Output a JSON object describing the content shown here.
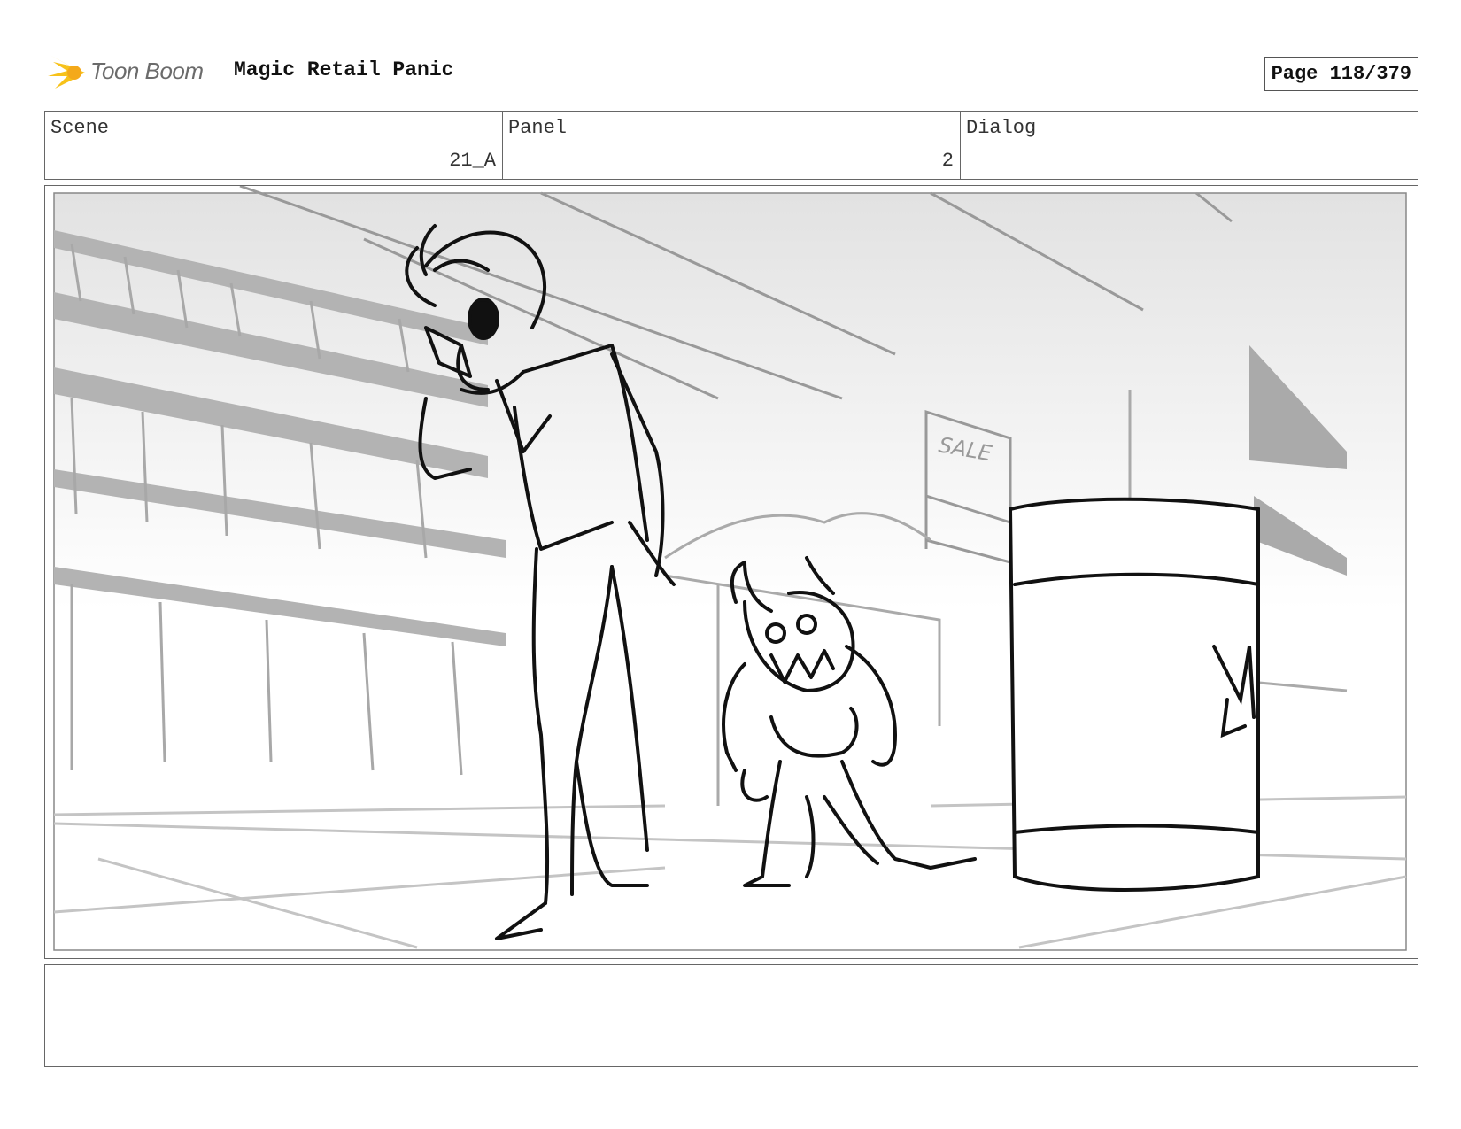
{
  "header": {
    "logo_text": "Toon Boom",
    "project_title": "Magic Retail Panic",
    "page_label": "Page 118/379"
  },
  "info": {
    "scene_label": "Scene",
    "scene_value": "21_A",
    "panel_label": "Panel",
    "panel_value": "2",
    "dialog_label": "Dialog",
    "dialog_value": ""
  },
  "panel": {
    "sign_text": "SALE",
    "characters": [
      "tall-demon-on-phone",
      "small-demon-growling"
    ]
  },
  "notes": {
    "text": ""
  }
}
